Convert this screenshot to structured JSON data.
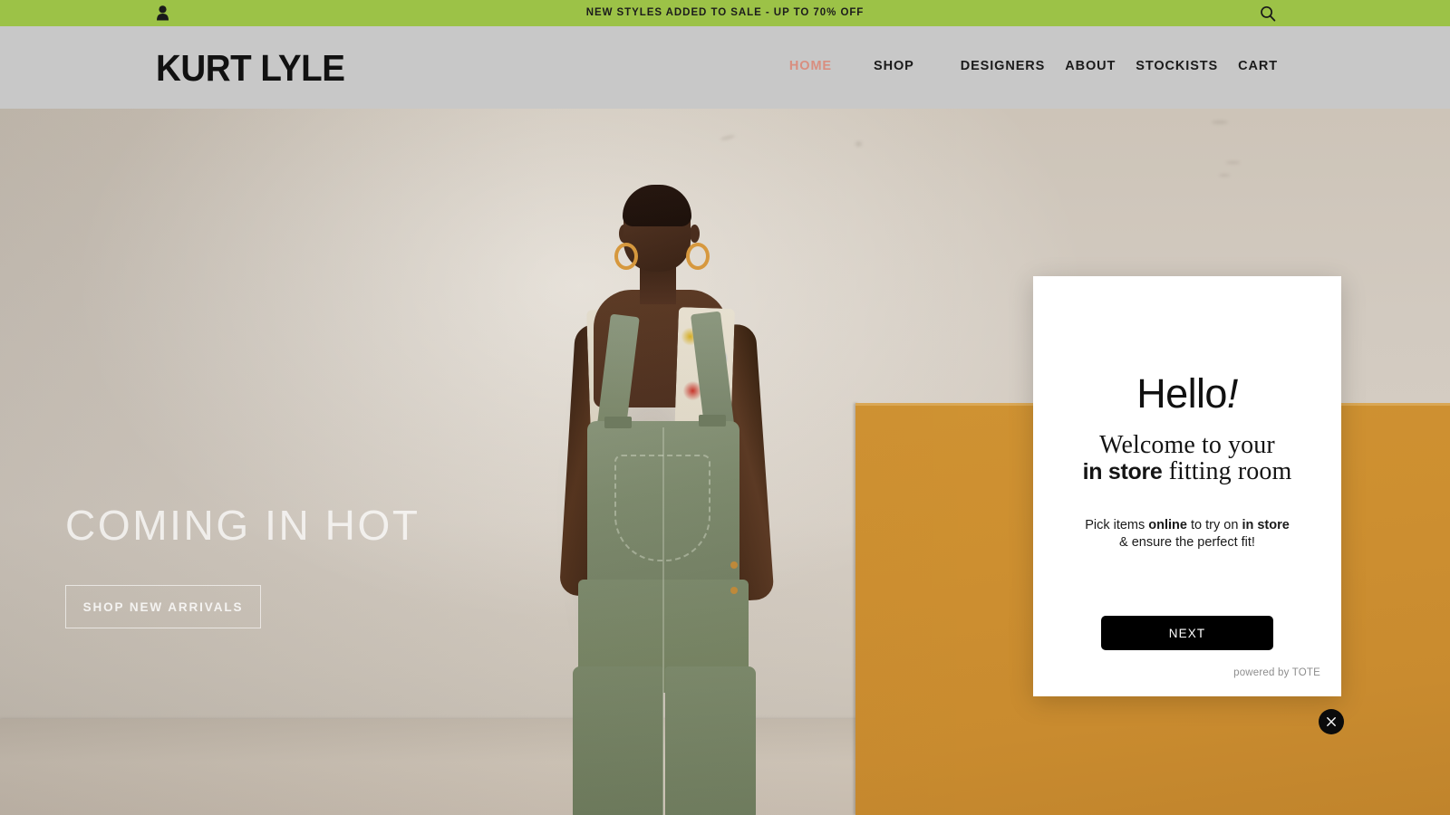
{
  "announcement": {
    "text": "NEW STYLES ADDED TO SALE - UP TO 70% OFF",
    "background_color": "#9cc247",
    "account_icon": "account-person-icon",
    "search_icon": "search-magnifier-icon"
  },
  "header": {
    "logo": "KURT LYLE",
    "background_color": "#c8c8c8",
    "nav": [
      {
        "label": "HOME",
        "active": true,
        "color": "#d98e7f"
      },
      {
        "label": "SHOP",
        "active": false
      },
      {
        "label": "DESIGNERS",
        "active": false
      },
      {
        "label": "ABOUT",
        "active": false
      },
      {
        "label": "STOCKISTS",
        "active": false
      },
      {
        "label": "CART",
        "active": false
      }
    ]
  },
  "hero": {
    "title": "COMING IN HOT",
    "cta_label": "SHOP NEW ARRIVALS",
    "backdrop_color": "#d2cac0",
    "plinth_color": "#cd8f30",
    "garment_color": "#7e8b6e"
  },
  "modal": {
    "heading_text": "Hello",
    "heading_mark": "!",
    "welcome_line1": "Welcome to your",
    "welcome_bold": "in store",
    "welcome_line2_rest": " fitting room",
    "sub_prefix": "Pick items ",
    "sub_bold1": "online",
    "sub_mid": " to try on ",
    "sub_bold2": "in store",
    "sub_line2": "& ensure the perfect fit!",
    "next_label": "NEXT",
    "powered_by": "powered by TOTE",
    "close_icon": "close-x-icon",
    "background_color": "#ffffff",
    "button_color": "#000000"
  }
}
